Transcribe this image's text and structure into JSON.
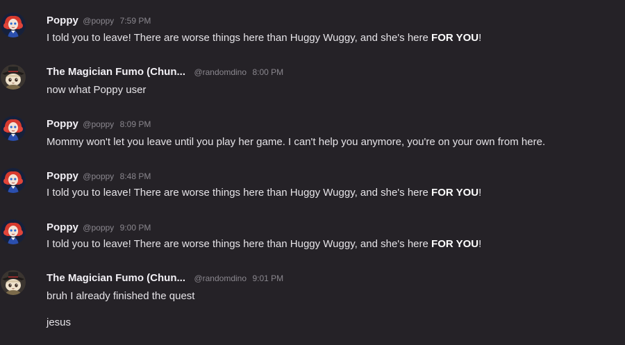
{
  "users": {
    "poppy": {
      "name": "Poppy",
      "handle": "@poppy",
      "avatar_icon": "poppy-doll-avatar-icon"
    },
    "magician": {
      "name": "The Magician Fumo (Chun...",
      "handle": "@randomdino",
      "avatar_icon": "fumo-avatar-icon"
    }
  },
  "messages": [
    {
      "time": "7:59 PM",
      "lines": [
        {
          "pre": "I told you to leave! There are worse things here than Huggy Wuggy, and she's here ",
          "bold": "FOR YOU",
          "post": "!"
        }
      ]
    },
    {
      "time": "8:00 PM",
      "lines": [
        {
          "text": "now what Poppy user"
        }
      ]
    },
    {
      "time": "8:09 PM",
      "lines": [
        {
          "text": "Mommy won't let you leave until you play her game. I can't help you anymore, you're on your own from here."
        }
      ]
    },
    {
      "time": "8:48 PM",
      "lines": [
        {
          "pre": "I told you to leave! There are worse things here than Huggy Wuggy, and she's here ",
          "bold": "FOR YOU",
          "post": "!"
        }
      ]
    },
    {
      "time": "9:00 PM",
      "lines": [
        {
          "pre": "I told you to leave! There are worse things here than Huggy Wuggy, and she's here ",
          "bold": "FOR YOU",
          "post": "!"
        }
      ]
    },
    {
      "time": "9:01 PM",
      "lines": [
        {
          "text": "bruh I already finished the quest"
        },
        {
          "text": "jesus"
        }
      ]
    }
  ],
  "colors": {
    "background": "#252227",
    "username": "#f2f0f5",
    "message_text": "#e6e4e8",
    "meta_text": "#8a878e"
  }
}
